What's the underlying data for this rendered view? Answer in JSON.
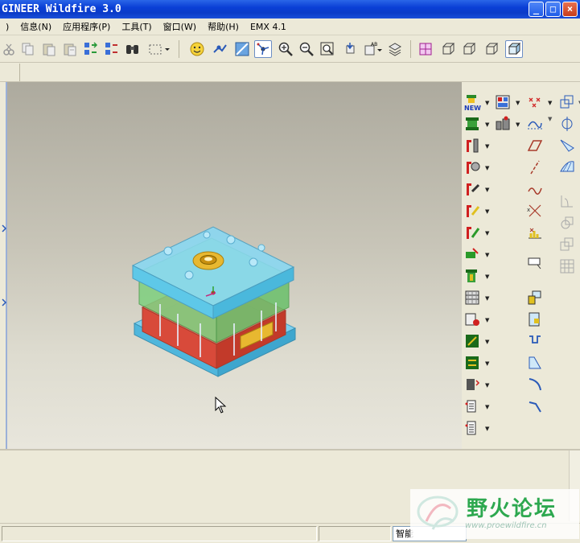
{
  "window": {
    "title": "GINEER Wildfire 3.0",
    "controls": {
      "minimize": "_",
      "maximize": "□",
      "close": "×"
    }
  },
  "menubar": {
    "items": [
      ")",
      "信息(N)",
      "应用程序(P)",
      "工具(T)",
      "窗口(W)",
      "帮助(H)",
      "EMX 4.1"
    ]
  },
  "toolbar": {
    "icons": [
      "cut-icon",
      "copy-icon",
      "paste-icon",
      "paste-special-icon",
      "regenerate-icon",
      "regenerate-manager-icon",
      "find-icon",
      "select-box-icon",
      "smiley-icon",
      "model-tree-icon",
      "repaint-icon",
      "spin-center-icon",
      "zoom-in-icon",
      "zoom-out-icon",
      "refit-icon",
      "reorient-icon",
      "saved-views-icon",
      "layers-icon",
      "wireframe-icon",
      "hidden-line-icon",
      "no-hidden-icon",
      "shading-icon",
      "enhanced-realism-icon"
    ]
  },
  "statusbar": {
    "filter_value": "智能"
  },
  "watermark": {
    "text": "野火论坛",
    "url": "www.proewildfire.cn"
  },
  "colors": {
    "title_bar": "#0a3fd6",
    "viewport_top": "#adaa9e",
    "viewport_bottom": "#e8e6dc",
    "mold_blue": "#5ec8e8",
    "mold_green": "#7ed07e",
    "mold_red": "#d84a3a",
    "mold_gold": "#e8b830"
  }
}
